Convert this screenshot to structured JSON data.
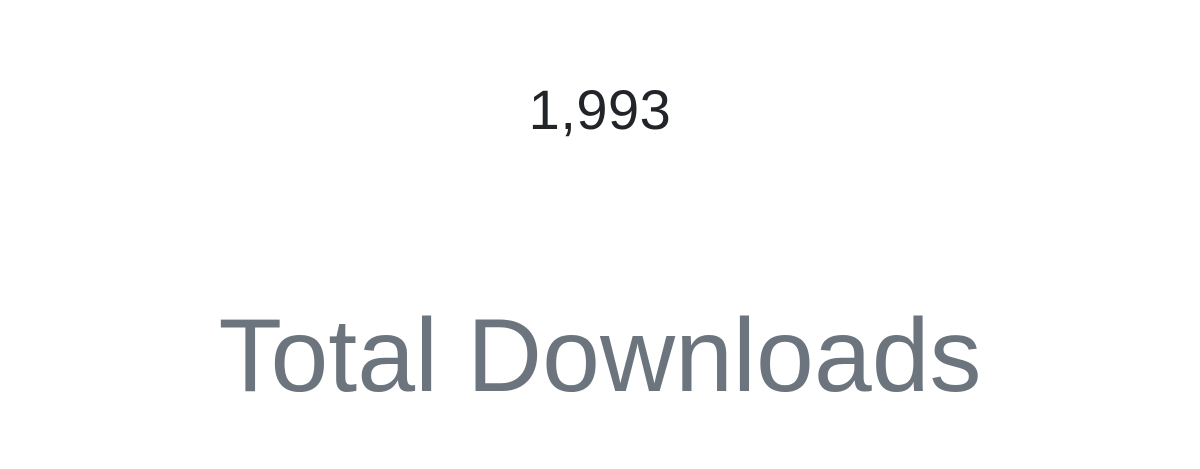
{
  "stat": {
    "value": "1,993",
    "label": "Total Downloads"
  },
  "colors": {
    "background": "#ffffff",
    "value_text": "#212529",
    "label_text": "#6c757d"
  }
}
